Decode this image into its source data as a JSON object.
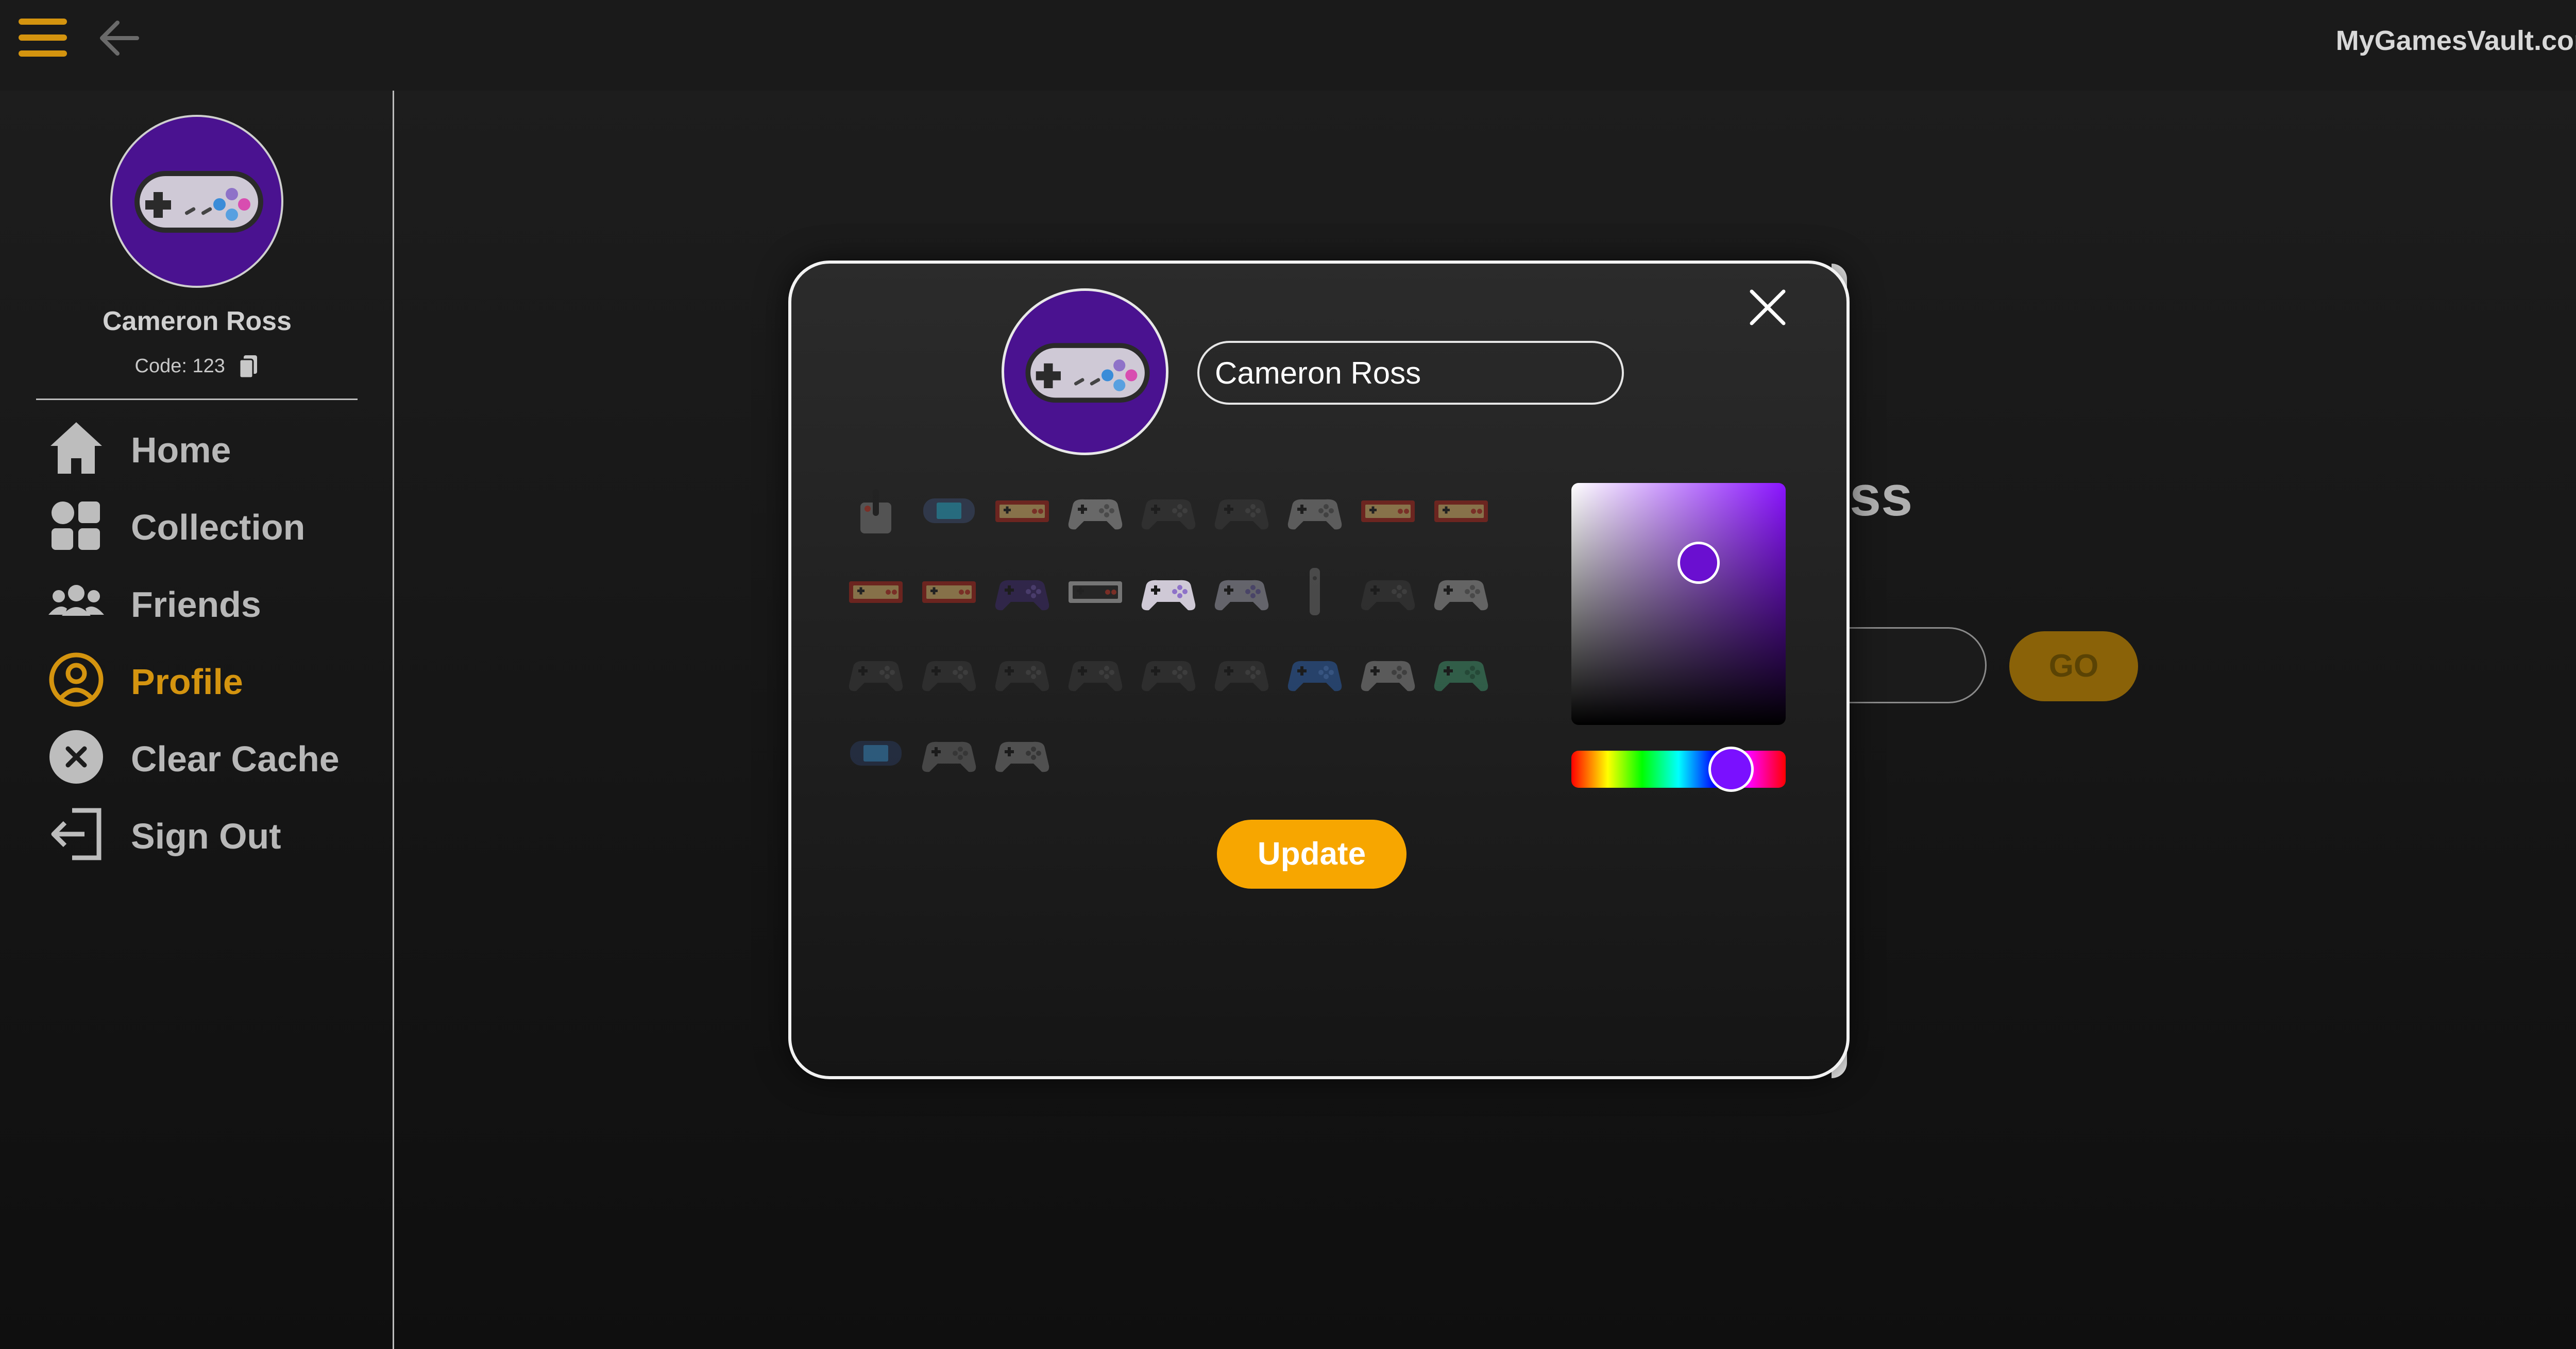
{
  "header": {
    "site_title": "MyGamesVault.com",
    "menu_icon": "hamburger-menu-icon",
    "back_icon": "arrow-left-icon"
  },
  "sidebar": {
    "user_name": "Cameron Ross",
    "code_text": "Code: 123",
    "avatar_icon": "snes-controller-icon",
    "items": [
      {
        "label": "Home",
        "icon": "home-icon",
        "active": false
      },
      {
        "label": "Collection",
        "icon": "grid-icon",
        "active": false
      },
      {
        "label": "Friends",
        "icon": "users-icon",
        "active": false
      },
      {
        "label": "Profile",
        "icon": "user-circle-icon",
        "active": true
      },
      {
        "label": "Clear Cache",
        "icon": "x-circle-icon",
        "active": false
      },
      {
        "label": "Sign Out",
        "icon": "sign-out-icon",
        "active": false
      }
    ]
  },
  "background_page": {
    "heading_fragment": "ss",
    "go_label": "GO"
  },
  "modal": {
    "name_value": "Cameron Ross",
    "update_label": "Update",
    "avatar_color": "#4a1290",
    "selected_hue_color": "#8a14ff",
    "controller_icons": [
      "atari-joystick-icon",
      "gameboy-advance-icon",
      "famicom-controller-icon",
      "wii-classic-controller-icon",
      "genesis-3-button-icon",
      "xbox-original-icon",
      "n64-controller-icon",
      "famicom-controller-icon",
      "famicom-controller-icon",
      "famicom-controller-icon",
      "famicom-controller-icon",
      "gamecube-controller-icon",
      "nes-controller-icon",
      "snes-controller-icon",
      "snes-us-controller-icon",
      "wii-remote-icon",
      "ouya-controller-icon",
      "dreamcast-controller-icon",
      "genesis-6-button-icon",
      "saturn-controller-icon",
      "saturn-controller-icon",
      "wii-u-pro-controller-icon",
      "dualshock-dark-icon",
      "dualshock-black-icon",
      "dualshock-blue-icon",
      "dualshock-grey-icon",
      "dualshock-green-icon",
      "handheld-console-icon",
      "xbox-360-controller-icon",
      "xbox-controller-icon"
    ],
    "selected_icon_index": 13
  }
}
